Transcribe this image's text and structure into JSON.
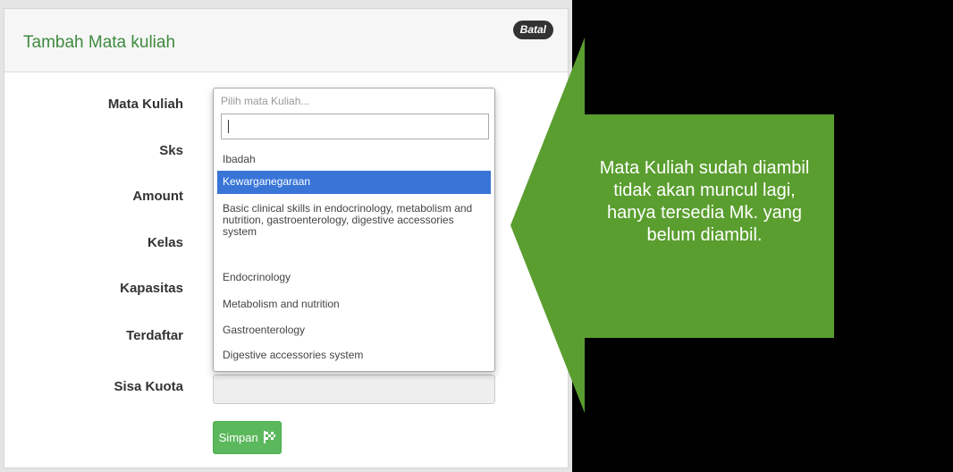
{
  "modal": {
    "title": "Tambah Mata kuliah",
    "close_label": "Batal"
  },
  "form": {
    "labels": {
      "mata_kuliah": "Mata Kuliah",
      "sks": "Sks",
      "amount": "Amount",
      "kelas": "Kelas",
      "kapasitas": "Kapasitas",
      "terdaftar": "Terdaftar",
      "sisa_kuota": "Sisa Kuota"
    },
    "select_placeholder": "Pilih mata Kuliah...",
    "search_value": "",
    "options": [
      "Ibadah",
      "Kewarganegaraan",
      "Basic clinical skills in endocrinology, metabolism and nutrition, gastroenterology, digestive accessories system",
      "Endocrinology",
      "Metabolism and nutrition",
      "Gastroenterology",
      "Digestive accessories system"
    ],
    "highlighted_option": "Kewarganegaraan",
    "submit_label": "Simpan",
    "submit_icon": "flag-icon"
  },
  "callout": {
    "text": "Mata Kuliah sudah diambil tidak akan muncul lagi, hanya tersedia Mk. yang belum diambil.",
    "color": "#5a9e2f"
  },
  "colors": {
    "title": "#3e8a3e",
    "highlight": "#3875d7",
    "button": "#5cb85c"
  }
}
